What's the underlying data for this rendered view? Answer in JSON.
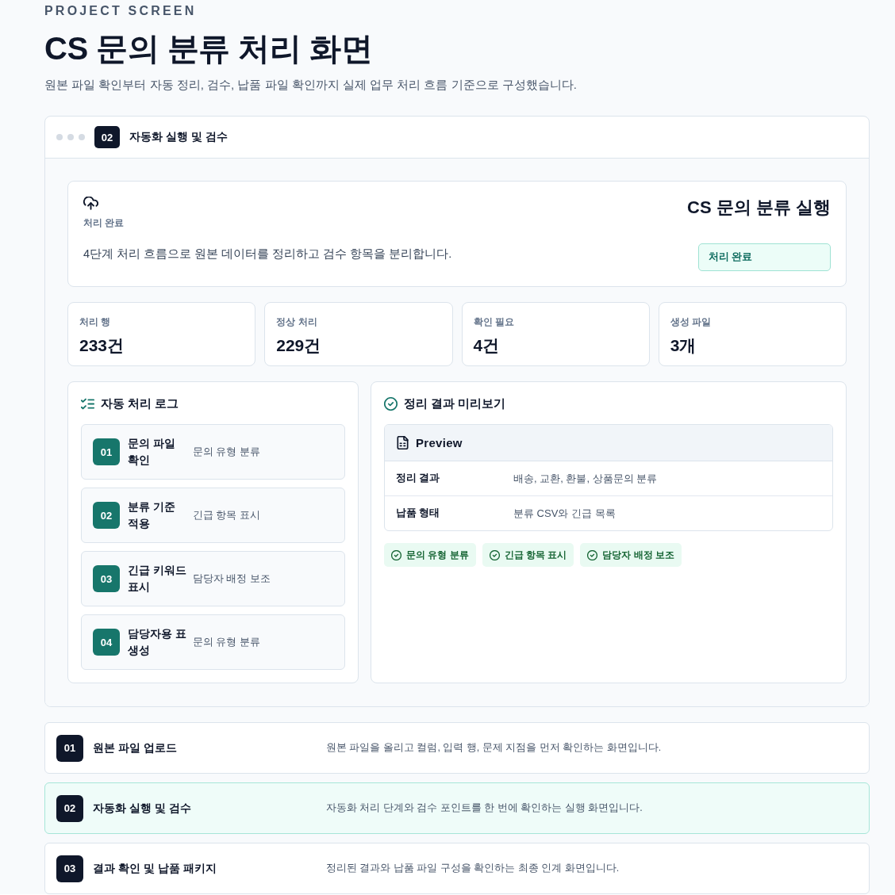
{
  "header": {
    "eyebrow": "PROJECT SCREEN",
    "title": "CS 문의 분류 처리 화면",
    "subtitle": "원본 파일 확인부터 자동 정리, 검수, 납품 파일 확인까지 실제 업무 처리 흐름 기준으로 구성했습니다."
  },
  "screen": {
    "number": "02",
    "title": "자동화 실행 및 검수"
  },
  "summary": {
    "label": "처리 완료",
    "description": "4단계 처리 흐름으로 원본 데이터를 정리하고 검수 항목을 분리합니다.",
    "title": "CS 문의 분류 실행",
    "status": "처리 완료"
  },
  "stats": [
    {
      "label": "처리 행",
      "value": "233건"
    },
    {
      "label": "정상 처리",
      "value": "229건"
    },
    {
      "label": "확인 필요",
      "value": "4건"
    },
    {
      "label": "생성 파일",
      "value": "3개"
    }
  ],
  "log": {
    "title": "자동 처리 로그",
    "steps": [
      {
        "number": "01",
        "title": "문의 파일 확인",
        "description": "문의 유형 분류"
      },
      {
        "number": "02",
        "title": "분류 기준 적용",
        "description": "긴급 항목 표시"
      },
      {
        "number": "03",
        "title": "긴급 키워드 표시",
        "description": "담당자 배정 보조"
      },
      {
        "number": "04",
        "title": "담당자용 표 생성",
        "description": "문의 유형 분류"
      }
    ]
  },
  "preview": {
    "title": "정리 결과 미리보기",
    "table_title": "Preview",
    "rows": [
      {
        "label": "정리 결과",
        "value": "배송, 교환, 환불, 상품문의 분류"
      },
      {
        "label": "납품 형태",
        "value": "분류 CSV와 긴급 목록"
      }
    ],
    "tags": [
      "문의 유형 분류",
      "긴급 항목 표시",
      "담당자 배정 보조"
    ]
  },
  "screens": [
    {
      "number": "01",
      "title": "원본 파일 업로드",
      "description": "원본 파일을 올리고 컬럼, 입력 행, 문제 지점을 먼저 확인하는 화면입니다.",
      "selected": false
    },
    {
      "number": "02",
      "title": "자동화 실행 및 검수",
      "description": "자동화 처리 단계와 검수 포인트를 한 번에 확인하는 실행 화면입니다.",
      "selected": true
    },
    {
      "number": "03",
      "title": "결과 확인 및 납품 패키지",
      "description": "정리된 결과와 납품 파일 구성을 확인하는 최종 인계 화면입니다.",
      "selected": false
    }
  ]
}
